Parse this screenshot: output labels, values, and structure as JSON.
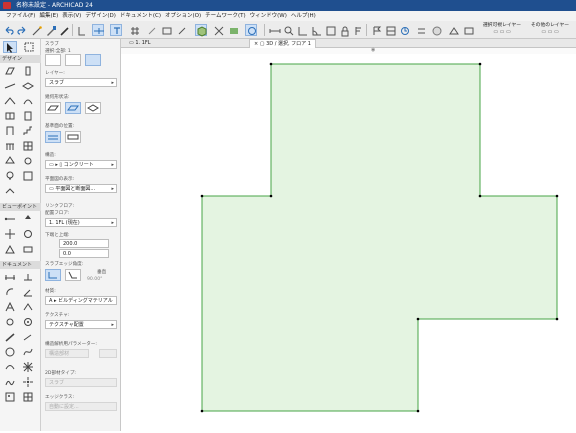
{
  "window": {
    "title": "名称未設定 - ARCHICAD 24"
  },
  "menu": [
    "ファイル(F)",
    "編集(E)",
    "表示(V)",
    "デザイン(D)",
    "ドキュメント(C)",
    "オプション(O)",
    "チームワーク(T)",
    "ウィンドウ(W)",
    "ヘルプ(H)"
  ],
  "toolbar": {
    "layer_combo_label": "選択可視レイヤー",
    "layer_combo_label2": "その他のレイヤー"
  },
  "tabs": {
    "plan": "1. 1FL",
    "view3d": "3D / 選択, フロア 1"
  },
  "toolbox": {
    "design": "デザイン",
    "viewpoint": "ビューポイント",
    "document": "ドキュメント"
  },
  "infobox": {
    "tool_name": "スラブ",
    "selected_count": "選択:全部: 1",
    "layer_label": "レイヤー:",
    "layer_value": "スラブ",
    "geometry_label": "幾何形状法:",
    "ref_plane_label": "基準面の位置:",
    "structure_label": "構造:",
    "structure_value": "コンクリート",
    "floor_plan_label": "平面図の表示:",
    "floor_plan_value": "平面図と断面図...",
    "linked_floor_label": "リンクフロア:",
    "home_story_label": "配置フロア:",
    "home_story_value": "1. 1FL (現在)",
    "thickness_label": "下端と上端:",
    "thickness_value": "200.0",
    "offset_value": "0.0",
    "edge_angle_label": "スラブエッジ角度:",
    "edge_angle_mode": "垂直",
    "edge_angle_value": "90.00°",
    "material_label": "材質:",
    "material_value": "ビルディングマテリアル",
    "texture_label": "テクスチャ:",
    "texture_value": "テクスチャ配置",
    "params_label": "構造解析用パラメーター:",
    "params_value": "構造部材",
    "type_label": "2D部材タイプ:",
    "type_value": "スラブ",
    "class_label": "エッジクラス:",
    "class_value": "自動に設定..."
  },
  "colors": {
    "slab_fill": "#e4f4e1",
    "slab_stroke": "#47a447",
    "accent": "#cde0f6",
    "titlebar": "#1f4f8f"
  }
}
